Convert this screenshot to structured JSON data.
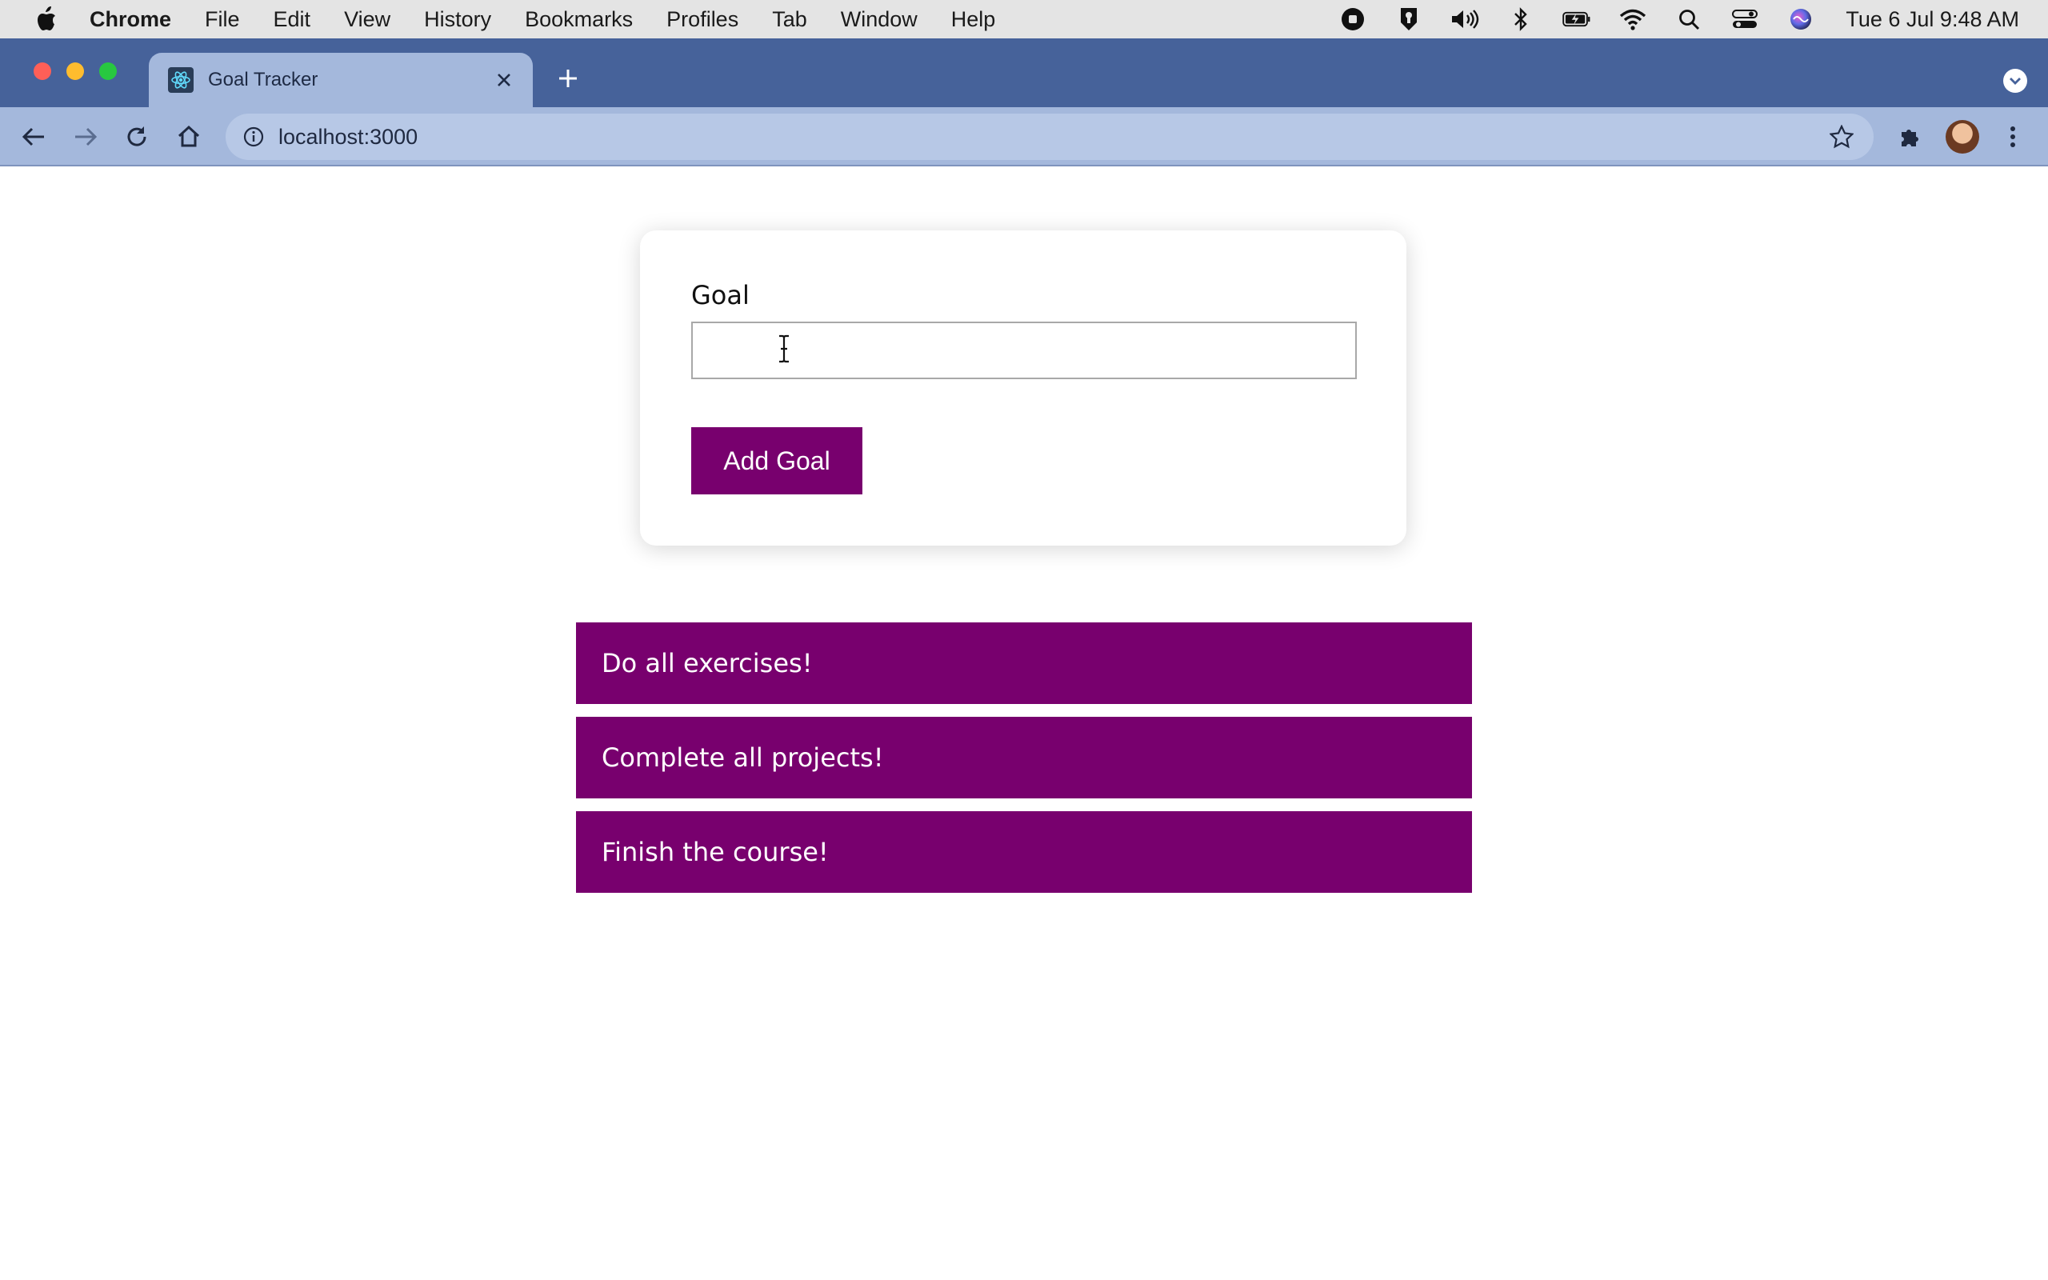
{
  "menubar": {
    "items": [
      "Chrome",
      "File",
      "Edit",
      "View",
      "History",
      "Bookmarks",
      "Profiles",
      "Tab",
      "Window",
      "Help"
    ],
    "clock": "Tue 6 Jul  9:48 AM"
  },
  "browser": {
    "tab_title": "Goal Tracker",
    "url": "localhost:3000"
  },
  "form": {
    "label": "Goal",
    "input_value": "",
    "add_button_label": "Add Goal"
  },
  "goals": [
    {
      "text": "Do all exercises!"
    },
    {
      "text": "Complete all projects!"
    },
    {
      "text": "Finish the course!"
    }
  ],
  "colors": {
    "accent": "#78006e",
    "tabstrip": "#46629a",
    "toolbar": "#a4b8dc"
  }
}
